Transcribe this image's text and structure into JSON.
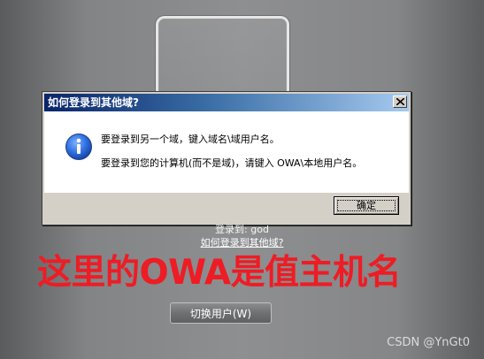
{
  "login_screen": {
    "login_to": "登录到: god",
    "other_domain_link": "如何登录到其他域?",
    "switch_user_button": "切换用户(W)"
  },
  "annotation": {
    "text": "这里的OWA是值主机名",
    "color": "#ee1c24"
  },
  "watermark": "CSDN @YnGt0",
  "dialog": {
    "title": "如何登录到其他域?",
    "icon": "info-icon",
    "message_line1": "要登录到另一个域，键入域名\\域用户名。",
    "message_line2": "要登录到您的计算机(而不是域)，请键入 OWA\\本地用户名。",
    "ok_button": "确定",
    "close_icon": "close-icon"
  }
}
